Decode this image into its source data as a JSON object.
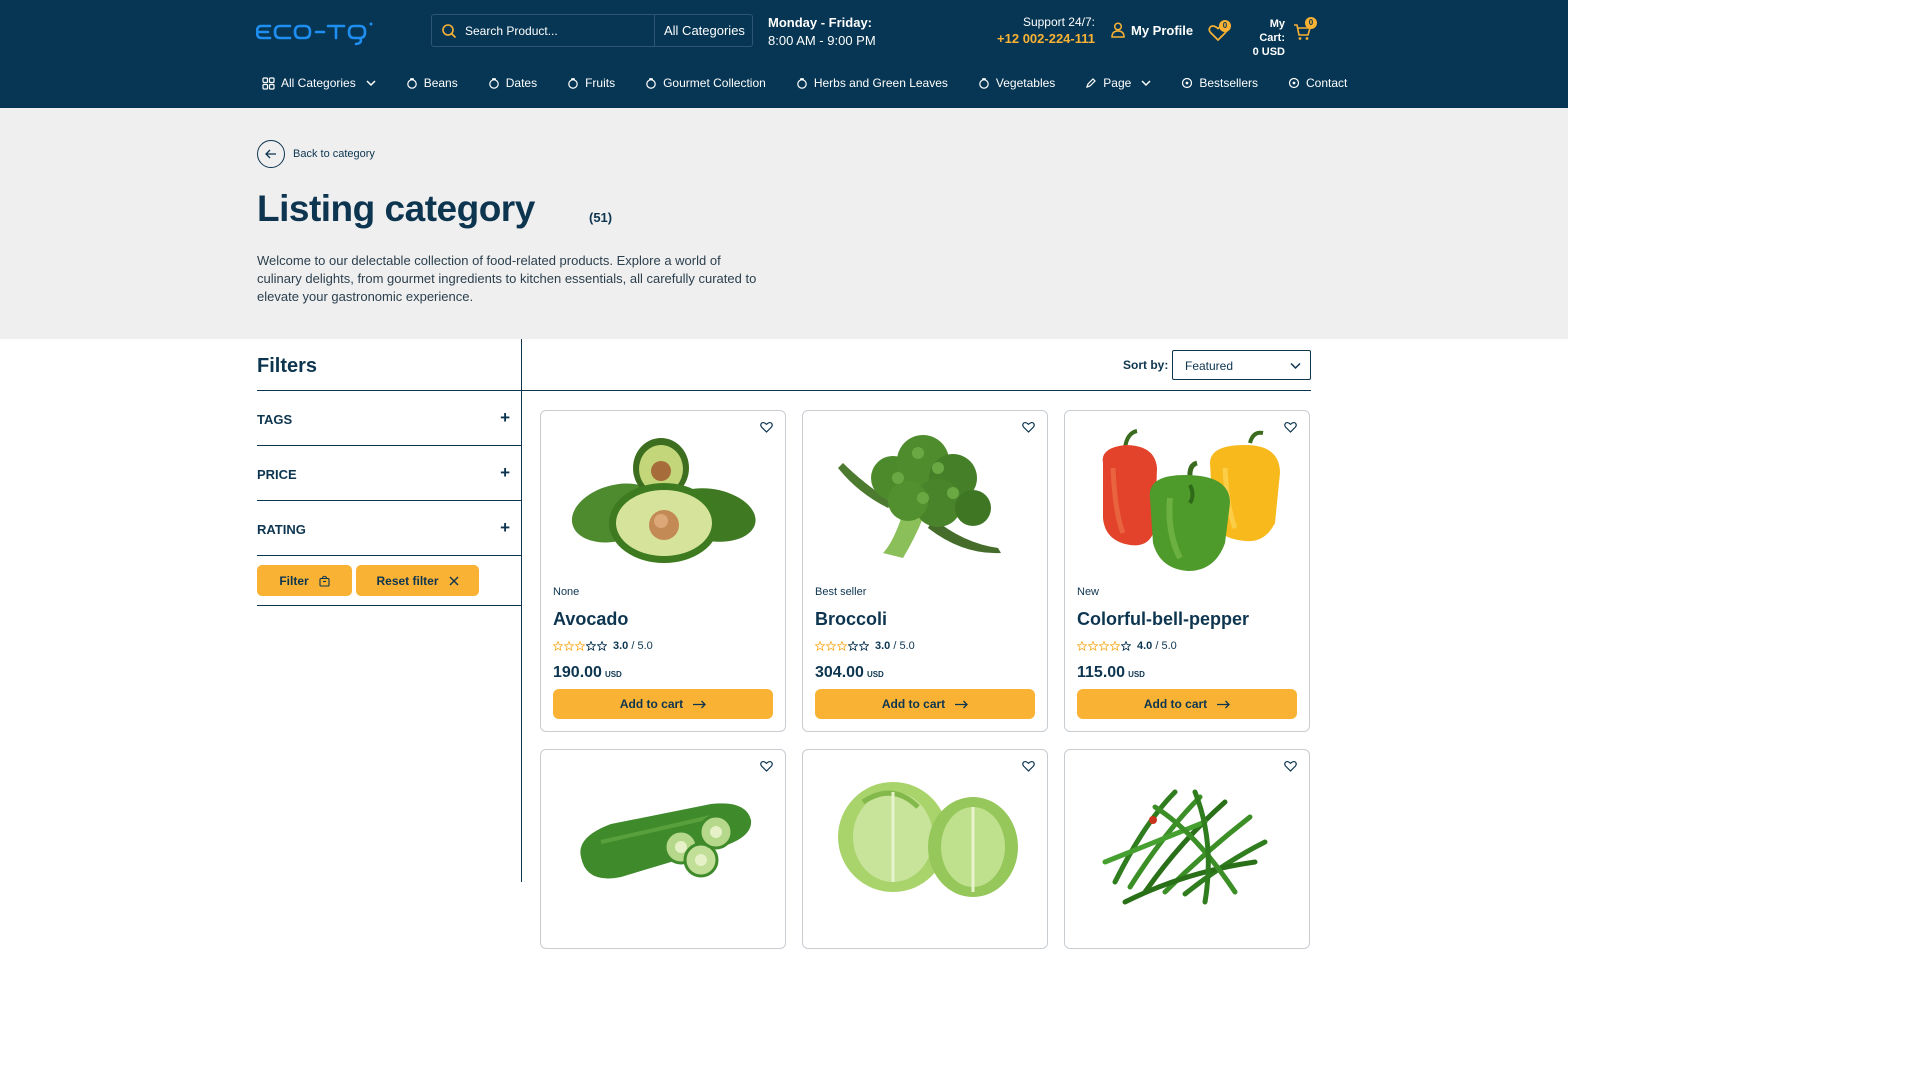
{
  "header": {
    "logo_text": "ECO-TO",
    "search_placeholder": "Search Product...",
    "search_category": "All Categories",
    "hours_days": "Monday - Friday:",
    "hours_time": "8:00 AM - 9:00 PM",
    "support_label": "Support 24/7:",
    "support_phone": "+12 002-224-111",
    "profile_label": "My Profile",
    "wishlist_count": "0",
    "cart_label": "My Cart:",
    "cart_total": "0 USD",
    "cart_count": "0"
  },
  "nav": {
    "items": [
      {
        "label": "All Categories",
        "icon": "grid-icon",
        "dropdown": true
      },
      {
        "label": "Beans",
        "icon": "food-icon"
      },
      {
        "label": "Dates",
        "icon": "food-icon"
      },
      {
        "label": "Fruits",
        "icon": "food-icon"
      },
      {
        "label": "Gourmet Collection",
        "icon": "food-icon"
      },
      {
        "label": "Herbs and Green Leaves",
        "icon": "food-icon"
      },
      {
        "label": "Vegetables",
        "icon": "food-icon"
      },
      {
        "label": "Page",
        "icon": "pen-icon",
        "dropdown": true
      },
      {
        "label": "Bestsellers",
        "icon": "badge-icon"
      },
      {
        "label": "Contact",
        "icon": "badge-icon"
      }
    ]
  },
  "hero": {
    "back_label": "Back to category",
    "title": "Listing category",
    "count": "(51)",
    "description": "Welcome to our delectable collection of food-related products. Explore a world of culinary delights, from gourmet ingredients to kitchen essentials, all carefully curated to elevate your gastronomic experience."
  },
  "filters": {
    "title": "Filters",
    "sections": [
      "TAGS",
      "PRICE",
      "RATING"
    ],
    "expand_symbol": "+",
    "filter_button": "Filter",
    "reset_button": "Reset filter"
  },
  "sort": {
    "label": "Sort by:",
    "value": "Featured"
  },
  "products": [
    {
      "tag": "None",
      "name": "Avocado",
      "rating": "3.0",
      "rating_max": "/ 5.0",
      "stars": 3,
      "price": "190.00",
      "currency": "USD",
      "cta": "Add to cart"
    },
    {
      "tag": "Best seller",
      "name": "Broccoli",
      "rating": "3.0",
      "rating_max": "/ 5.0",
      "stars": 3,
      "price": "304.00",
      "currency": "USD",
      "cta": "Add to cart"
    },
    {
      "tag": "New",
      "name": "Colorful-bell-pepper",
      "rating": "4.0",
      "rating_max": "/ 5.0",
      "stars": 4,
      "price": "115.00",
      "currency": "USD",
      "cta": "Add to cart"
    },
    {
      "tag": "",
      "name": "",
      "image": "cucumber"
    },
    {
      "tag": "",
      "name": "",
      "image": "lettuce"
    },
    {
      "tag": "",
      "name": "",
      "image": "green-beans"
    }
  ],
  "colors": {
    "header_bg": "#063653",
    "accent": "#f9b233",
    "text_dark": "#0d3550",
    "hero_bg": "#efefef"
  }
}
